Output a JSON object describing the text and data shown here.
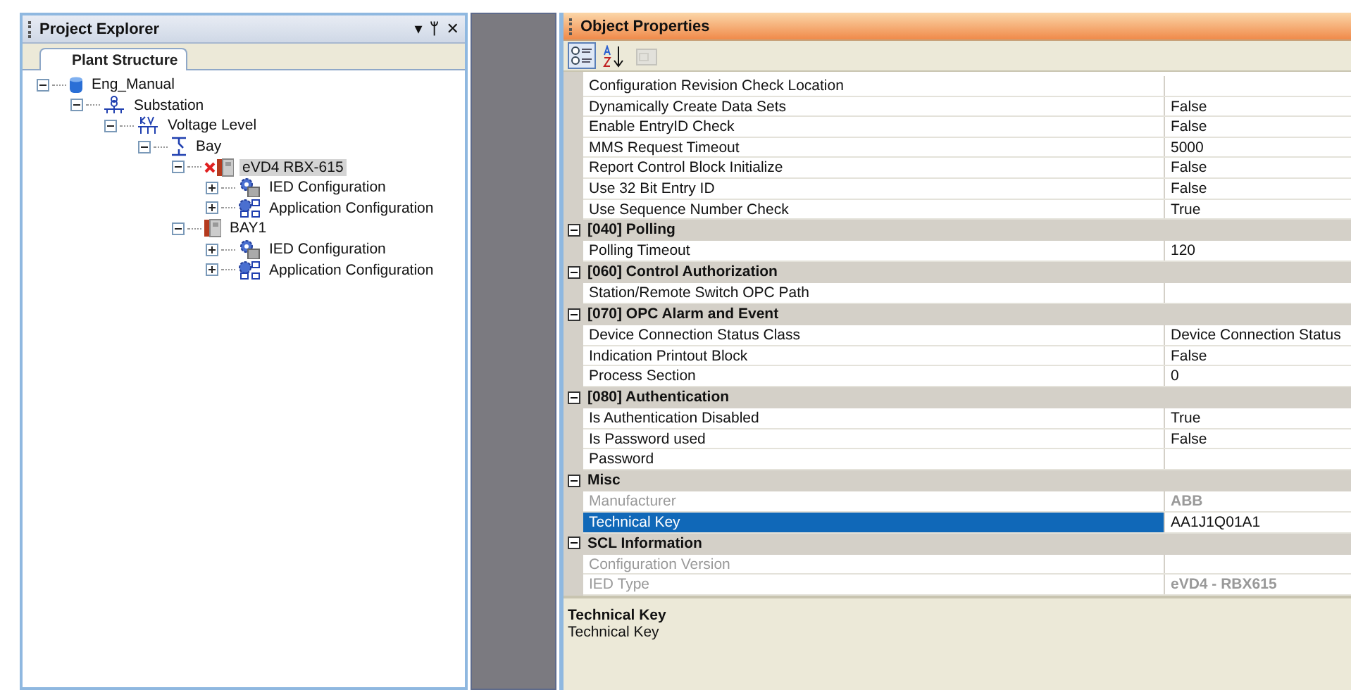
{
  "project_explorer": {
    "title": "Project Explorer",
    "menu_glyph": "▾",
    "pin_glyph": "ᛘ",
    "close_glyph": "✕",
    "tabs": [
      {
        "label": "Plant Structure",
        "selected": true
      }
    ],
    "tree": [
      {
        "label": "Eng_Manual",
        "kind": "database",
        "expanded": true,
        "selected": false,
        "error": false,
        "children": [
          {
            "label": "Substation",
            "kind": "substation",
            "expanded": true,
            "selected": false,
            "error": false,
            "children": [
              {
                "label": "Voltage Level",
                "kind": "voltage",
                "expanded": true,
                "selected": false,
                "error": false,
                "children": [
                  {
                    "label": "Bay",
                    "kind": "bay",
                    "expanded": true,
                    "selected": false,
                    "error": false,
                    "children": [
                      {
                        "label": "eVD4 RBX-615",
                        "kind": "ied",
                        "expanded": true,
                        "selected": true,
                        "error": true,
                        "children": [
                          {
                            "label": "IED Configuration",
                            "kind": "config",
                            "expanded": false,
                            "selected": false,
                            "error": false
                          },
                          {
                            "label": "Application Configuration",
                            "kind": "appconfig",
                            "expanded": false,
                            "selected": false,
                            "error": false
                          }
                        ]
                      },
                      {
                        "label": "BAY1",
                        "kind": "ied",
                        "expanded": true,
                        "selected": false,
                        "error": false,
                        "children": [
                          {
                            "label": "IED Configuration",
                            "kind": "config",
                            "expanded": false,
                            "selected": false,
                            "error": false
                          },
                          {
                            "label": "Application Configuration",
                            "kind": "appconfig",
                            "expanded": false,
                            "selected": false,
                            "error": false
                          }
                        ]
                      }
                    ]
                  }
                ]
              }
            ]
          }
        ]
      }
    ]
  },
  "object_properties": {
    "title": "Object Properties",
    "toolbar": [
      {
        "kind": "categorized",
        "selected": true,
        "disabled": false
      },
      {
        "kind": "alphabetical",
        "selected": false,
        "disabled": false
      },
      {
        "kind": "pages",
        "selected": false,
        "disabled": true
      }
    ],
    "groups": [
      {
        "rows": [
          {
            "name": "Configuration Revision Check Location",
            "value": "",
            "disabled": false,
            "selected": false
          },
          {
            "name": "Dynamically Create Data Sets",
            "value": "False",
            "disabled": false,
            "selected": false
          },
          {
            "name": "Enable EntryID Check",
            "value": "False",
            "disabled": false,
            "selected": false
          },
          {
            "name": "MMS Request Timeout",
            "value": "5000",
            "disabled": false,
            "selected": false
          },
          {
            "name": "Report Control Block Initialize",
            "value": "False",
            "disabled": false,
            "selected": false
          },
          {
            "name": "Use 32 Bit Entry ID",
            "value": "False",
            "disabled": false,
            "selected": false
          },
          {
            "name": "Use Sequence Number Check",
            "value": "True",
            "disabled": false,
            "selected": false
          }
        ]
      },
      {
        "title": "[040] Polling",
        "expanded": true,
        "rows": [
          {
            "name": "Polling Timeout",
            "value": "120",
            "disabled": false,
            "selected": false
          }
        ]
      },
      {
        "title": "[060] Control Authorization",
        "expanded": true,
        "rows": [
          {
            "name": "Station/Remote Switch OPC Path",
            "value": "",
            "disabled": false,
            "selected": false
          }
        ]
      },
      {
        "title": "[070] OPC Alarm and Event",
        "expanded": true,
        "rows": [
          {
            "name": "Device Connection Status Class",
            "value": "Device Connection Status",
            "disabled": false,
            "selected": false
          },
          {
            "name": "Indication Printout Block",
            "value": "False",
            "disabled": false,
            "selected": false
          },
          {
            "name": "Process Section",
            "value": "0",
            "disabled": false,
            "selected": false
          }
        ]
      },
      {
        "title": "[080] Authentication",
        "expanded": true,
        "rows": [
          {
            "name": "Is Authentication Disabled",
            "value": "True",
            "disabled": false,
            "selected": false
          },
          {
            "name": "Is Password used",
            "value": "False",
            "disabled": false,
            "selected": false
          },
          {
            "name": "Password",
            "value": "",
            "disabled": false,
            "selected": false
          }
        ]
      },
      {
        "title": "Misc",
        "expanded": true,
        "rows": [
          {
            "name": "Manufacturer",
            "value": "ABB",
            "disabled": true,
            "selected": false
          },
          {
            "name": "Technical Key",
            "value": "AA1J1Q01A1",
            "disabled": false,
            "selected": true
          }
        ]
      },
      {
        "title": "SCL Information",
        "expanded": true,
        "rows": [
          {
            "name": "Configuration Version",
            "value": "",
            "disabled": true,
            "selected": false
          },
          {
            "name": "IED Type",
            "value": "eVD4 - RBX615",
            "disabled": true,
            "selected": false
          }
        ]
      }
    ],
    "description": {
      "title": "Technical Key",
      "text": "Technical Key"
    }
  }
}
